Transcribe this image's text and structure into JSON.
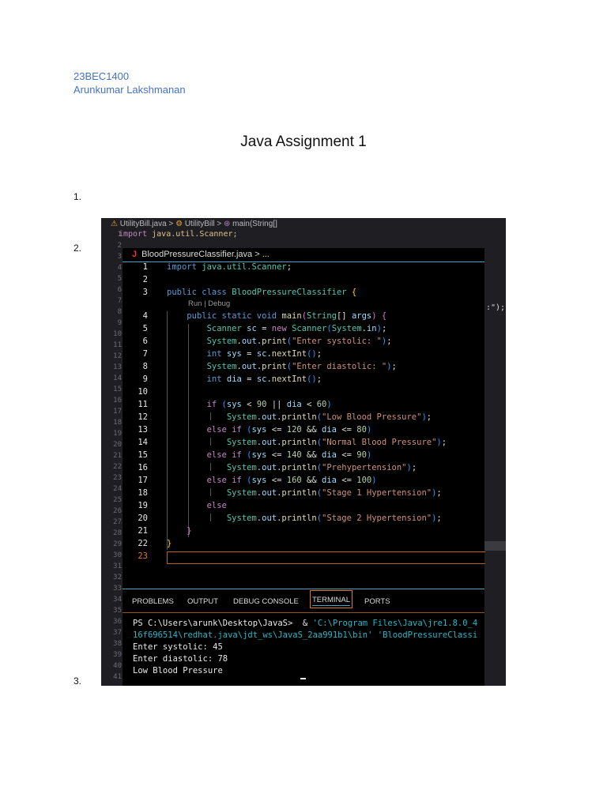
{
  "header": {
    "student_id": "23BEC1400",
    "student_name": "Arunkumar Lakshmanan"
  },
  "title": "Java Assignment 1",
  "list_numbers": [
    "1.",
    "2.",
    "3."
  ],
  "screenshot": {
    "outer_breadcrumb": {
      "file": "UtilityBill.java",
      "class": "UtilityBill",
      "method": "main(String[]"
    },
    "outer_line1": {
      "kw": "import",
      "rest": " java.util.Scanner;"
    },
    "outer_fragment": ":\");",
    "editor_breadcrumb": {
      "icon": "J",
      "file": "BloodPressureClassifier.java",
      "rest": "..."
    },
    "codelens": "Run | Debug",
    "code_lines": [
      {
        "n": "1",
        "t": [
          [
            "kw",
            "import"
          ],
          [
            "pl",
            " "
          ],
          [
            "ty",
            "java.util.Scanner"
          ],
          [
            "pl",
            ";"
          ]
        ]
      },
      {
        "n": "2",
        "t": []
      },
      {
        "n": "3",
        "t": [
          [
            "kw",
            "public class "
          ],
          [
            "ty",
            "BloodPressureClassifier"
          ],
          [
            "pl",
            " "
          ],
          [
            "br1",
            "{"
          ]
        ]
      },
      {
        "n": "4",
        "t": [
          [
            "pl",
            "    "
          ],
          [
            "kw",
            "public static void "
          ],
          [
            "fn",
            "main"
          ],
          [
            "br2",
            "("
          ],
          [
            "ty",
            "String"
          ],
          [
            "pl",
            "[] "
          ],
          [
            "va",
            "args"
          ],
          [
            "br2",
            ")"
          ],
          [
            "pl",
            " "
          ],
          [
            "br2",
            "{"
          ]
        ]
      },
      {
        "n": "5",
        "t": [
          [
            "pl",
            "        "
          ],
          [
            "ty",
            "Scanner"
          ],
          [
            "pl",
            " "
          ],
          [
            "va",
            "sc"
          ],
          [
            "pl",
            " = "
          ],
          [
            "kw2",
            "new "
          ],
          [
            "ty",
            "Scanner"
          ],
          [
            "br3",
            "("
          ],
          [
            "ty",
            "System"
          ],
          [
            "pl",
            "."
          ],
          [
            "va",
            "in"
          ],
          [
            "br3",
            ")"
          ],
          [
            "pl",
            ";"
          ]
        ]
      },
      {
        "n": "6",
        "t": [
          [
            "pl",
            "        "
          ],
          [
            "ty",
            "System"
          ],
          [
            "pl",
            "."
          ],
          [
            "va",
            "out"
          ],
          [
            "pl",
            "."
          ],
          [
            "fn",
            "print"
          ],
          [
            "br3",
            "("
          ],
          [
            "str",
            "\"Enter systolic: \""
          ],
          [
            "br3",
            ")"
          ],
          [
            "pl",
            ";"
          ]
        ]
      },
      {
        "n": "7",
        "t": [
          [
            "pl",
            "        "
          ],
          [
            "kw",
            "int "
          ],
          [
            "va",
            "sys"
          ],
          [
            "pl",
            " = "
          ],
          [
            "va",
            "sc"
          ],
          [
            "pl",
            "."
          ],
          [
            "fn",
            "nextInt"
          ],
          [
            "br3",
            "()"
          ],
          [
            "pl",
            ";"
          ]
        ]
      },
      {
        "n": "8",
        "t": [
          [
            "pl",
            "        "
          ],
          [
            "ty",
            "System"
          ],
          [
            "pl",
            "."
          ],
          [
            "va",
            "out"
          ],
          [
            "pl",
            "."
          ],
          [
            "fn",
            "print"
          ],
          [
            "br3",
            "("
          ],
          [
            "str",
            "\"Enter diastolic: \""
          ],
          [
            "br3",
            ")"
          ],
          [
            "pl",
            ";"
          ]
        ]
      },
      {
        "n": "9",
        "t": [
          [
            "pl",
            "        "
          ],
          [
            "kw",
            "int "
          ],
          [
            "va",
            "dia"
          ],
          [
            "pl",
            " = "
          ],
          [
            "va",
            "sc"
          ],
          [
            "pl",
            "."
          ],
          [
            "fn",
            "nextInt"
          ],
          [
            "br3",
            "()"
          ],
          [
            "pl",
            ";"
          ]
        ]
      },
      {
        "n": "10",
        "t": []
      },
      {
        "n": "11",
        "t": [
          [
            "pl",
            "        "
          ],
          [
            "kw2",
            "if "
          ],
          [
            "br3",
            "("
          ],
          [
            "va",
            "sys"
          ],
          [
            "pl",
            " < "
          ],
          [
            "nu",
            "90"
          ],
          [
            "pl",
            " || "
          ],
          [
            "va",
            "dia"
          ],
          [
            "pl",
            " < "
          ],
          [
            "nu",
            "60"
          ],
          [
            "br3",
            ")"
          ]
        ]
      },
      {
        "n": "12",
        "t": [
          [
            "pl",
            "            "
          ],
          [
            "ty",
            "System"
          ],
          [
            "pl",
            "."
          ],
          [
            "va",
            "out"
          ],
          [
            "pl",
            "."
          ],
          [
            "fn",
            "println"
          ],
          [
            "br3",
            "("
          ],
          [
            "str",
            "\"Low Blood Pressure\""
          ],
          [
            "br3",
            ")"
          ],
          [
            "pl",
            ";"
          ]
        ]
      },
      {
        "n": "13",
        "t": [
          [
            "pl",
            "        "
          ],
          [
            "kw2",
            "else if "
          ],
          [
            "br3",
            "("
          ],
          [
            "va",
            "sys"
          ],
          [
            "pl",
            " <= "
          ],
          [
            "nu",
            "120"
          ],
          [
            "pl",
            " && "
          ],
          [
            "va",
            "dia"
          ],
          [
            "pl",
            " <= "
          ],
          [
            "nu",
            "80"
          ],
          [
            "br3",
            ")"
          ]
        ]
      },
      {
        "n": "14",
        "t": [
          [
            "pl",
            "            "
          ],
          [
            "ty",
            "System"
          ],
          [
            "pl",
            "."
          ],
          [
            "va",
            "out"
          ],
          [
            "pl",
            "."
          ],
          [
            "fn",
            "println"
          ],
          [
            "br3",
            "("
          ],
          [
            "str",
            "\"Normal Blood Pressure\""
          ],
          [
            "br3",
            ")"
          ],
          [
            "pl",
            ";"
          ]
        ]
      },
      {
        "n": "15",
        "t": [
          [
            "pl",
            "        "
          ],
          [
            "kw2",
            "else if "
          ],
          [
            "br3",
            "("
          ],
          [
            "va",
            "sys"
          ],
          [
            "pl",
            " <= "
          ],
          [
            "nu",
            "140"
          ],
          [
            "pl",
            " && "
          ],
          [
            "va",
            "dia"
          ],
          [
            "pl",
            " <= "
          ],
          [
            "nu",
            "90"
          ],
          [
            "br3",
            ")"
          ]
        ]
      },
      {
        "n": "16",
        "t": [
          [
            "pl",
            "            "
          ],
          [
            "ty",
            "System"
          ],
          [
            "pl",
            "."
          ],
          [
            "va",
            "out"
          ],
          [
            "pl",
            "."
          ],
          [
            "fn",
            "println"
          ],
          [
            "br3",
            "("
          ],
          [
            "str",
            "\"Prehypertension\""
          ],
          [
            "br3",
            ")"
          ],
          [
            "pl",
            ";"
          ]
        ]
      },
      {
        "n": "17",
        "t": [
          [
            "pl",
            "        "
          ],
          [
            "kw2",
            "else if "
          ],
          [
            "br3",
            "("
          ],
          [
            "va",
            "sys"
          ],
          [
            "pl",
            " <= "
          ],
          [
            "nu",
            "160"
          ],
          [
            "pl",
            " && "
          ],
          [
            "va",
            "dia"
          ],
          [
            "pl",
            " <= "
          ],
          [
            "nu",
            "100"
          ],
          [
            "br3",
            ")"
          ]
        ]
      },
      {
        "n": "18",
        "t": [
          [
            "pl",
            "            "
          ],
          [
            "ty",
            "System"
          ],
          [
            "pl",
            "."
          ],
          [
            "va",
            "out"
          ],
          [
            "pl",
            "."
          ],
          [
            "fn",
            "println"
          ],
          [
            "br3",
            "("
          ],
          [
            "str",
            "\"Stage 1 Hypertension\""
          ],
          [
            "br3",
            ")"
          ],
          [
            "pl",
            ";"
          ]
        ]
      },
      {
        "n": "19",
        "t": [
          [
            "pl",
            "        "
          ],
          [
            "kw2",
            "else"
          ]
        ]
      },
      {
        "n": "20",
        "t": [
          [
            "pl",
            "            "
          ],
          [
            "ty",
            "System"
          ],
          [
            "pl",
            "."
          ],
          [
            "va",
            "out"
          ],
          [
            "pl",
            "."
          ],
          [
            "fn",
            "println"
          ],
          [
            "br3",
            "("
          ],
          [
            "str",
            "\"Stage 2 Hypertension\""
          ],
          [
            "br3",
            ")"
          ],
          [
            "pl",
            ";"
          ]
        ]
      },
      {
        "n": "21",
        "t": [
          [
            "pl",
            "    "
          ],
          [
            "br2",
            "}"
          ]
        ]
      },
      {
        "n": "22",
        "t": [
          [
            "br1",
            "}"
          ]
        ]
      },
      {
        "n": "23",
        "t": []
      }
    ],
    "panel_tabs": [
      "PROBLEMS",
      "OUTPUT",
      "DEBUG CONSOLE",
      "TERMINAL",
      "PORTS"
    ],
    "active_tab": "TERMINAL",
    "terminal": {
      "line1_prompt": "PS C:\\Users\\arunk\\Desktop\\JavaS>  & ",
      "line1_cmd": "'C:\\Program Files\\Java\\jre1.8.0_4",
      "line2": "16f696514\\redhat.java\\jdt_ws\\JavaS_2aa991b1\\bin' 'BloodPressureClassi",
      "output": [
        "Enter systolic: 45",
        "Enter diastolic: 78",
        "Low Blood Pressure"
      ]
    }
  }
}
